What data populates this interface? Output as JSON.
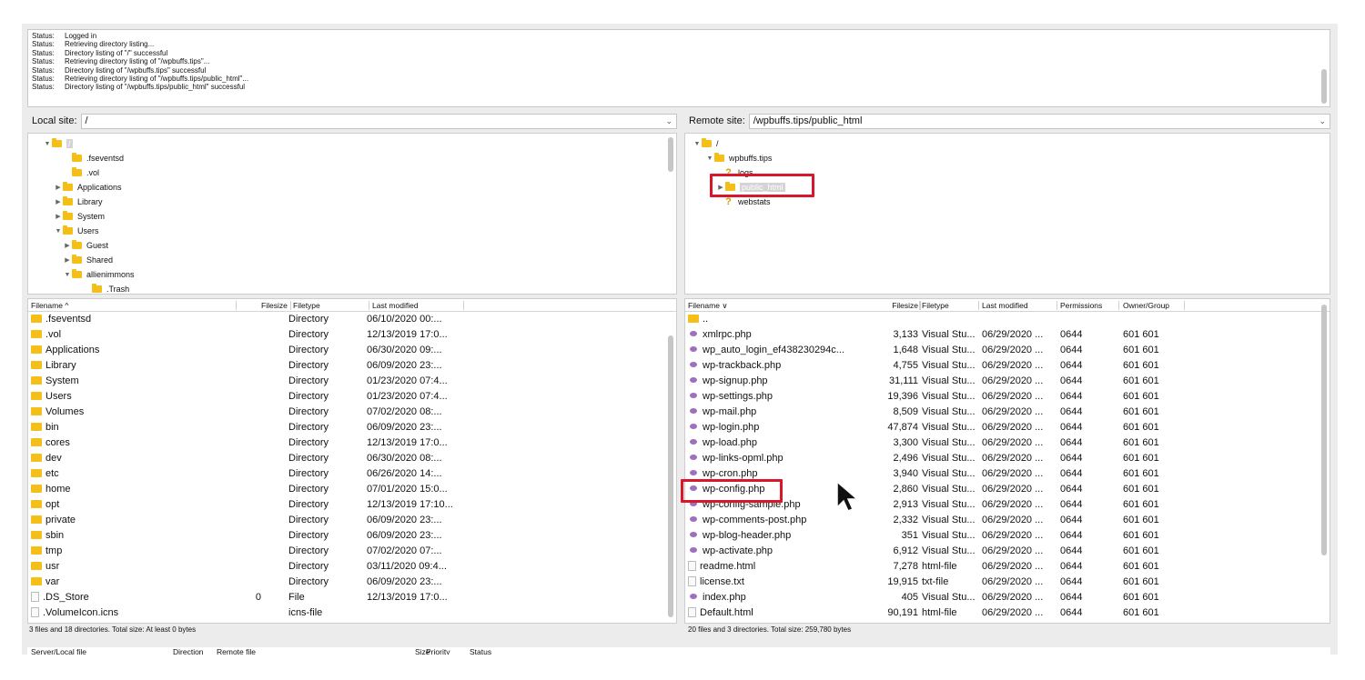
{
  "log": [
    {
      "label": "Status:",
      "text": "Logged in"
    },
    {
      "label": "Status:",
      "text": "Retrieving directory listing..."
    },
    {
      "label": "Status:",
      "text": "Directory listing of \"/\" successful"
    },
    {
      "label": "Status:",
      "text": "Retrieving directory listing of \"/wpbuffs.tips\"..."
    },
    {
      "label": "Status:",
      "text": "Directory listing of \"/wpbuffs.tips\" successful"
    },
    {
      "label": "Status:",
      "text": "Retrieving directory listing of \"/wpbuffs.tips/public_html\"..."
    },
    {
      "label": "Status:",
      "text": "Directory listing of \"/wpbuffs.tips/public_html\" successful"
    }
  ],
  "local": {
    "site_label": "Local site:",
    "site_value": "/",
    "tree": [
      {
        "name": "/",
        "expanded": true,
        "selected": true
      },
      {
        "name": ".fseventsd"
      },
      {
        "name": ".vol"
      },
      {
        "name": "Applications",
        "collapsed": true
      },
      {
        "name": "Library",
        "collapsed": true
      },
      {
        "name": "System",
        "collapsed": true
      },
      {
        "name": "Users",
        "expanded": true
      },
      {
        "name": "Guest",
        "collapsed": true
      },
      {
        "name": "Shared",
        "collapsed": true
      },
      {
        "name": "allienimmons",
        "expanded": true
      },
      {
        "name": ".Trash"
      }
    ],
    "columns": [
      "Filename ^",
      "Filesize",
      "Filetype",
      "Last modified"
    ],
    "files": [
      {
        "icon": "dir",
        "name": ".fseventsd",
        "size": "",
        "type": "Directory",
        "modified": "06/10/2020 00:..."
      },
      {
        "icon": "dir",
        "name": ".vol",
        "size": "",
        "type": "Directory",
        "modified": "12/13/2019 17:0..."
      },
      {
        "icon": "dir",
        "name": "Applications",
        "size": "",
        "type": "Directory",
        "modified": "06/30/2020 09:..."
      },
      {
        "icon": "dir",
        "name": "Library",
        "size": "",
        "type": "Directory",
        "modified": "06/09/2020 23:..."
      },
      {
        "icon": "dir",
        "name": "System",
        "size": "",
        "type": "Directory",
        "modified": "01/23/2020 07:4..."
      },
      {
        "icon": "dir",
        "name": "Users",
        "size": "",
        "type": "Directory",
        "modified": "01/23/2020 07:4..."
      },
      {
        "icon": "dir",
        "name": "Volumes",
        "size": "",
        "type": "Directory",
        "modified": "07/02/2020 08:..."
      },
      {
        "icon": "dir",
        "name": "bin",
        "size": "",
        "type": "Directory",
        "modified": "06/09/2020 23:..."
      },
      {
        "icon": "dir",
        "name": "cores",
        "size": "",
        "type": "Directory",
        "modified": "12/13/2019 17:0..."
      },
      {
        "icon": "dir",
        "name": "dev",
        "size": "",
        "type": "Directory",
        "modified": "06/30/2020 08:..."
      },
      {
        "icon": "dir",
        "name": "etc",
        "size": "",
        "type": "Directory",
        "modified": "06/26/2020 14:..."
      },
      {
        "icon": "dir",
        "name": "home",
        "size": "",
        "type": "Directory",
        "modified": "07/01/2020 15:0..."
      },
      {
        "icon": "dir",
        "name": "opt",
        "size": "",
        "type": "Directory",
        "modified": "12/13/2019 17:10..."
      },
      {
        "icon": "dir",
        "name": "private",
        "size": "",
        "type": "Directory",
        "modified": "06/09/2020 23:..."
      },
      {
        "icon": "dir",
        "name": "sbin",
        "size": "",
        "type": "Directory",
        "modified": "06/09/2020 23:..."
      },
      {
        "icon": "dir",
        "name": "tmp",
        "size": "",
        "type": "Directory",
        "modified": "07/02/2020 07:..."
      },
      {
        "icon": "dir",
        "name": "usr",
        "size": "",
        "type": "Directory",
        "modified": "03/11/2020 09:4..."
      },
      {
        "icon": "dir",
        "name": "var",
        "size": "",
        "type": "Directory",
        "modified": "06/09/2020 23:..."
      },
      {
        "icon": "doc",
        "name": ".DS_Store",
        "size": "0",
        "type": "File",
        "modified": "12/13/2019 17:0..."
      },
      {
        "icon": "doc",
        "name": ".VolumeIcon.icns",
        "size": "",
        "type": "icns-file",
        "modified": ""
      }
    ],
    "status": "3 files and 18 directories. Total size: At least 0 bytes"
  },
  "remote": {
    "site_label": "Remote site:",
    "site_value": "/wpbuffs.tips/public_html",
    "tree": [
      {
        "name": "/",
        "icon": "folder",
        "expanded": true
      },
      {
        "name": "wpbuffs.tips",
        "icon": "folder",
        "expanded": true
      },
      {
        "name": "logs",
        "icon": "unknown"
      },
      {
        "name": "public_html",
        "icon": "folder",
        "collapsed": true,
        "selected": true
      },
      {
        "name": "webstats",
        "icon": "unknown"
      }
    ],
    "columns": [
      "Filename ∨",
      "Filesize",
      "Filetype",
      "Last modified",
      "Permissions",
      "Owner/Group"
    ],
    "files": [
      {
        "icon": "dir",
        "name": "..",
        "size": "",
        "type": "",
        "modified": "",
        "perms": "",
        "owner": ""
      },
      {
        "icon": "php",
        "name": "xmlrpc.php",
        "size": "3,133",
        "type": "Visual Stu...",
        "modified": "06/29/2020 ...",
        "perms": "0644",
        "owner": "601 601"
      },
      {
        "icon": "php",
        "name": "wp_auto_login_ef438230294c...",
        "size": "1,648",
        "type": "Visual Stu...",
        "modified": "06/29/2020 ...",
        "perms": "0644",
        "owner": "601 601"
      },
      {
        "icon": "php",
        "name": "wp-trackback.php",
        "size": "4,755",
        "type": "Visual Stu...",
        "modified": "06/29/2020 ...",
        "perms": "0644",
        "owner": "601 601"
      },
      {
        "icon": "php",
        "name": "wp-signup.php",
        "size": "31,111",
        "type": "Visual Stu...",
        "modified": "06/29/2020 ...",
        "perms": "0644",
        "owner": "601 601"
      },
      {
        "icon": "php",
        "name": "wp-settings.php",
        "size": "19,396",
        "type": "Visual Stu...",
        "modified": "06/29/2020 ...",
        "perms": "0644",
        "owner": "601 601"
      },
      {
        "icon": "php",
        "name": "wp-mail.php",
        "size": "8,509",
        "type": "Visual Stu...",
        "modified": "06/29/2020 ...",
        "perms": "0644",
        "owner": "601 601"
      },
      {
        "icon": "php",
        "name": "wp-login.php",
        "size": "47,874",
        "type": "Visual Stu...",
        "modified": "06/29/2020 ...",
        "perms": "0644",
        "owner": "601 601"
      },
      {
        "icon": "php",
        "name": "wp-load.php",
        "size": "3,300",
        "type": "Visual Stu...",
        "modified": "06/29/2020 ...",
        "perms": "0644",
        "owner": "601 601"
      },
      {
        "icon": "php",
        "name": "wp-links-opml.php",
        "size": "2,496",
        "type": "Visual Stu...",
        "modified": "06/29/2020 ...",
        "perms": "0644",
        "owner": "601 601"
      },
      {
        "icon": "php",
        "name": "wp-cron.php",
        "size": "3,940",
        "type": "Visual Stu...",
        "modified": "06/29/2020 ...",
        "perms": "0644",
        "owner": "601 601"
      },
      {
        "icon": "php",
        "name": "wp-config.php",
        "size": "2,860",
        "type": "Visual Stu...",
        "modified": "06/29/2020 ...",
        "perms": "0644",
        "owner": "601 601",
        "highlighted": true
      },
      {
        "icon": "php",
        "name": "wp-config-sample.php",
        "size": "2,913",
        "type": "Visual Stu...",
        "modified": "06/29/2020 ...",
        "perms": "0644",
        "owner": "601 601"
      },
      {
        "icon": "php",
        "name": "wp-comments-post.php",
        "size": "2,332",
        "type": "Visual Stu...",
        "modified": "06/29/2020 ...",
        "perms": "0644",
        "owner": "601 601"
      },
      {
        "icon": "php",
        "name": "wp-blog-header.php",
        "size": "351",
        "type": "Visual Stu...",
        "modified": "06/29/2020 ...",
        "perms": "0644",
        "owner": "601 601"
      },
      {
        "icon": "php",
        "name": "wp-activate.php",
        "size": "6,912",
        "type": "Visual Stu...",
        "modified": "06/29/2020 ...",
        "perms": "0644",
        "owner": "601 601"
      },
      {
        "icon": "doc",
        "name": "readme.html",
        "size": "7,278",
        "type": "html-file",
        "modified": "06/29/2020 ...",
        "perms": "0644",
        "owner": "601 601"
      },
      {
        "icon": "doc",
        "name": "license.txt",
        "size": "19,915",
        "type": "txt-file",
        "modified": "06/29/2020 ...",
        "perms": "0644",
        "owner": "601 601"
      },
      {
        "icon": "php",
        "name": "index.php",
        "size": "405",
        "type": "Visual Stu...",
        "modified": "06/29/2020 ...",
        "perms": "0644",
        "owner": "601 601"
      },
      {
        "icon": "doc",
        "name": "Default.html",
        "size": "90,191",
        "type": "html-file",
        "modified": "06/29/2020 ...",
        "perms": "0644",
        "owner": "601 601"
      }
    ],
    "status": "20 files and 3 directories. Total size: 259,780 bytes"
  },
  "queue": {
    "columns": [
      "Server/Local file",
      "Direction",
      "Remote file",
      "Size",
      "Priority",
      "Status"
    ]
  },
  "colors": {
    "highlight_box": "#d8182a",
    "folder": "#f3bf18",
    "php_icon": "#9d6fbe"
  },
  "icons": {
    "cursor": "mouse-pointer-icon"
  }
}
